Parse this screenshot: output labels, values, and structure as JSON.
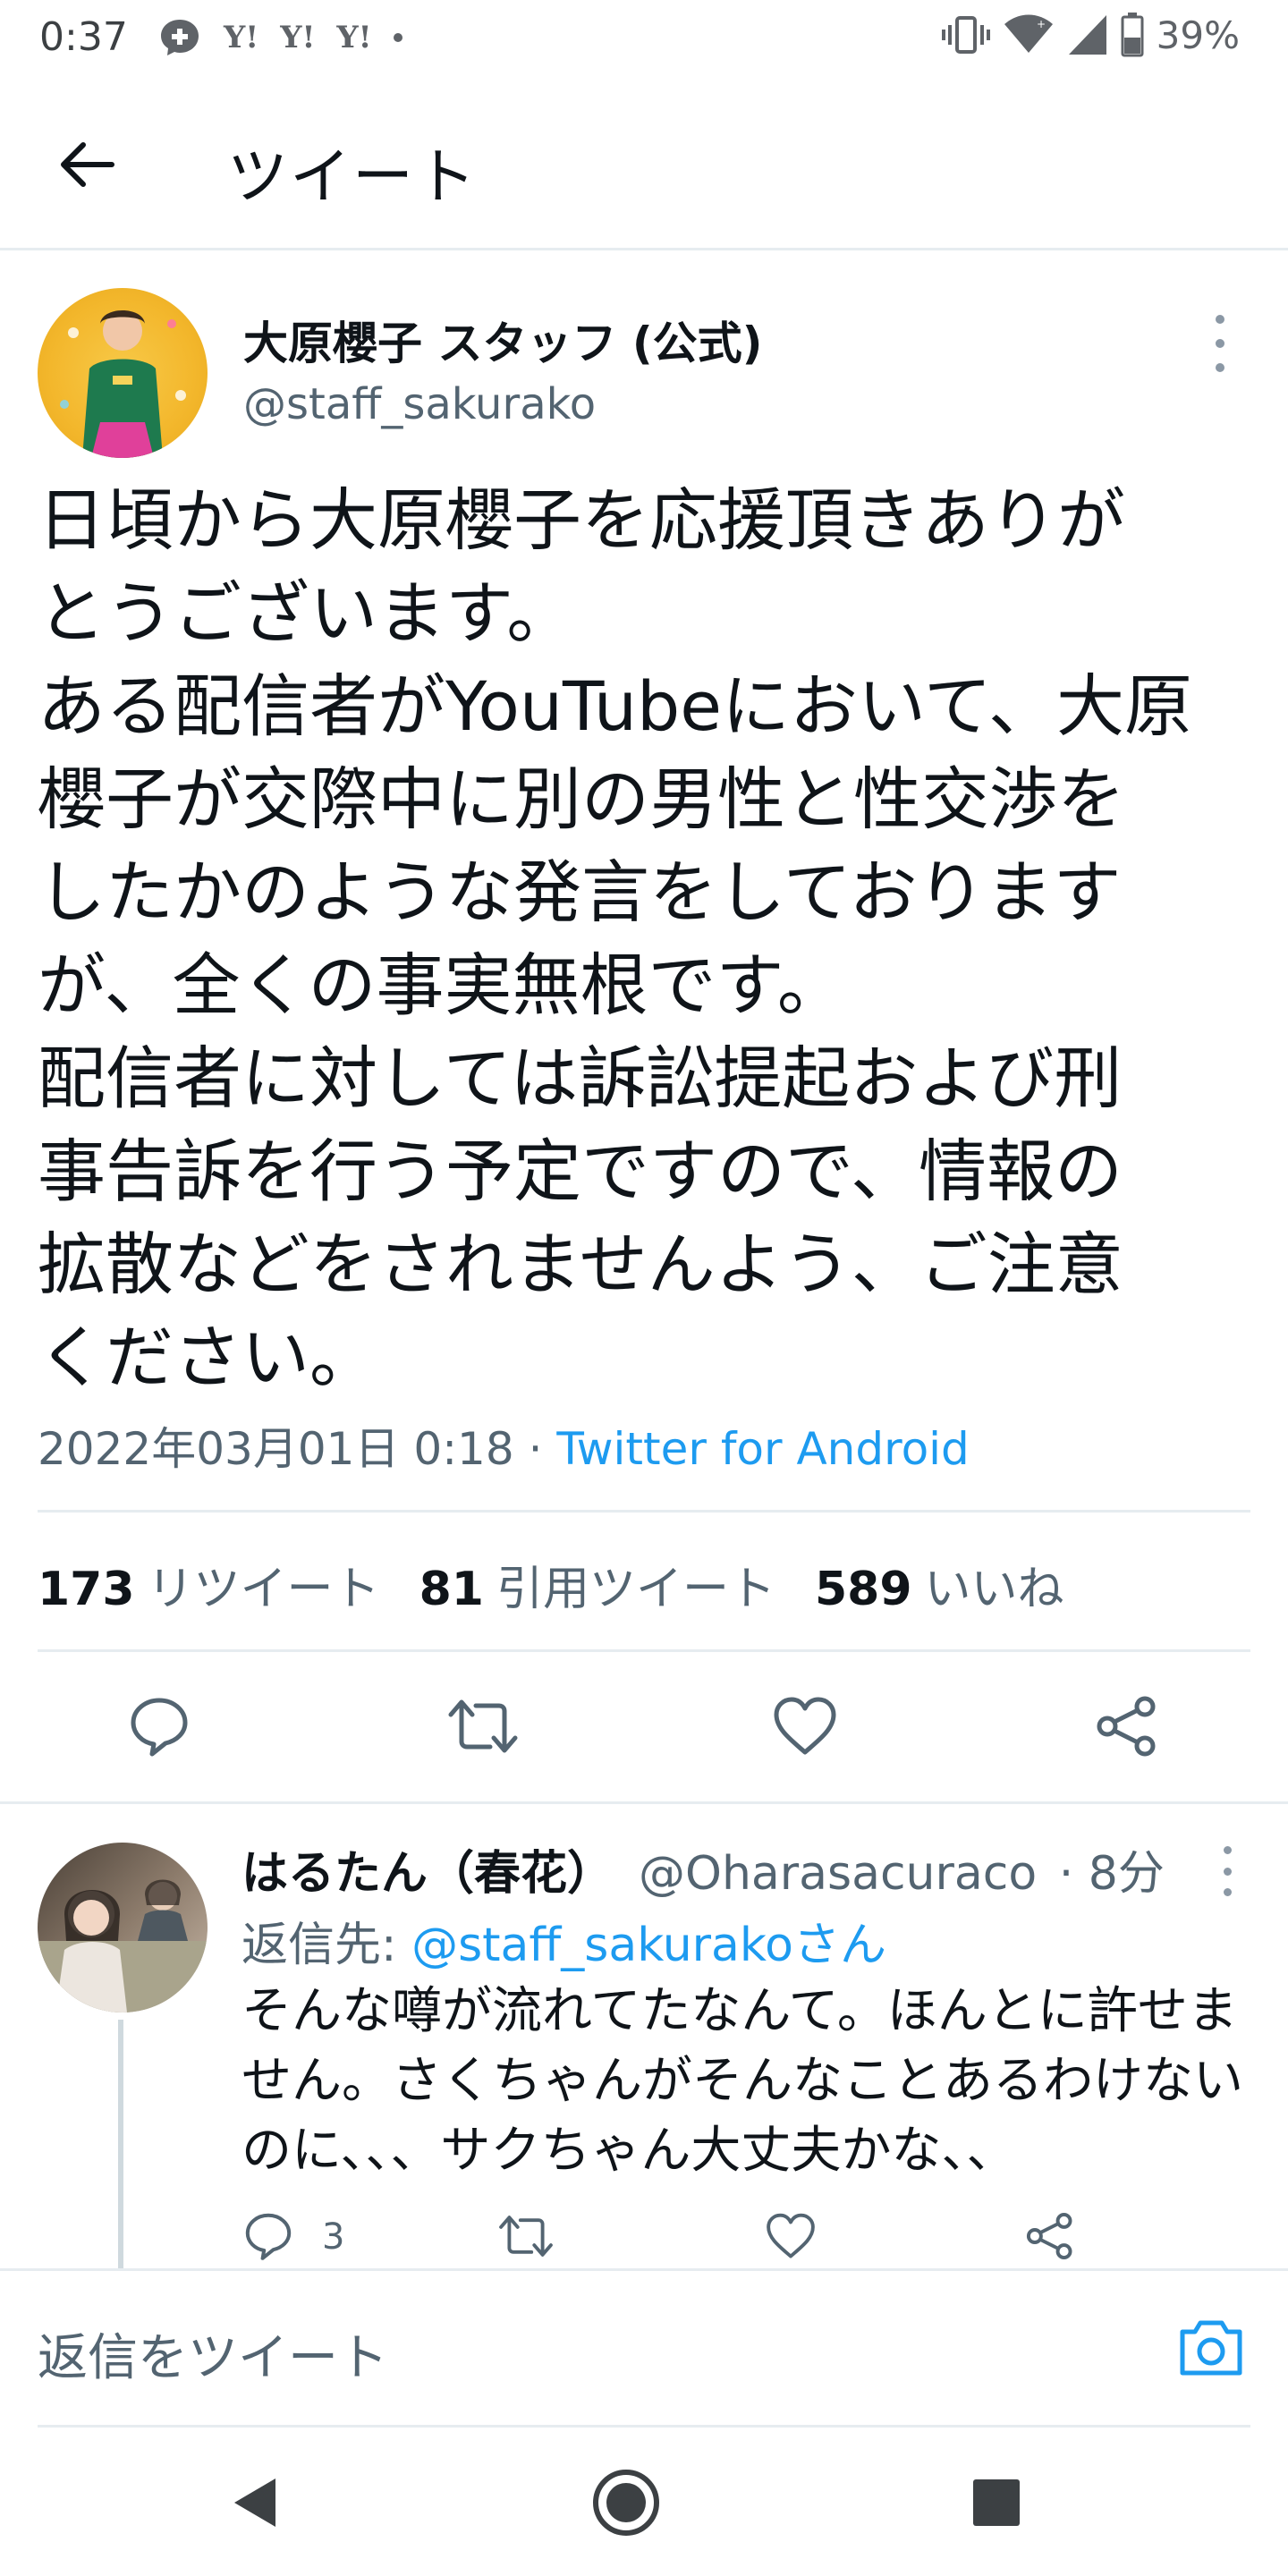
{
  "status_bar": {
    "time": "0:37",
    "left_icons": [
      "messenger-icon",
      "yahoo-icon",
      "yahoo-icon",
      "yahoo-icon",
      "notification-dot-icon"
    ],
    "yahoo_label": "Y!",
    "battery_percent": "39%",
    "right_icons": [
      "vibrate-icon",
      "wifi-icon",
      "signal-icon",
      "battery-icon"
    ]
  },
  "header": {
    "title": "ツイート",
    "back_icon": "arrow-left-icon"
  },
  "tweet": {
    "author_name": "大原櫻子 スタッフ (公式)",
    "author_handle": "@staff_sakurako",
    "text_lines": [
      "日頃から大原櫻子を応援頂きありが",
      "とうございます。",
      "ある配信者がYouTubeにおいて、大原",
      "櫻子が交際中に別の男性と性交渉を",
      "したかのような発言をしております",
      "が、全くの事実無根です。",
      "配信者に対しては訴訟提起および刑",
      "事告訴を行う予定ですので、情報の",
      "拡散などをされませんよう、ご注意",
      "ください。"
    ],
    "timestamp": "2022年03月01日 0:18",
    "separator": " · ",
    "client": "Twitter for Android",
    "stats": {
      "retweets_count": "173",
      "retweets_label": "リツイート",
      "quotes_count": "81",
      "quotes_label": "引用ツイート",
      "likes_count": "589",
      "likes_label": "いいね"
    },
    "actions": [
      "reply-icon",
      "retweet-icon",
      "like-icon",
      "share-icon"
    ]
  },
  "reply": {
    "author_name": "はるたん（春花）",
    "author_handle": "@Oharasacuraco",
    "time": "· 8分",
    "reply_to_prefix": "返信先: ",
    "reply_to_mention": "@staff_sakurakoさん",
    "text_lines": [
      "そんな噂が流れてたなんて。ほんとに許せま",
      "せん。さくちゃんがそんなことあるわけない",
      "のに、、、サクちゃん大丈夫かな、、"
    ],
    "reply_count": "3"
  },
  "compose": {
    "placeholder": "返信をツイート",
    "camera_icon": "camera-icon"
  },
  "nav_bar": {
    "buttons": [
      "back-triangle-icon",
      "home-circle-icon",
      "recents-square-icon"
    ]
  },
  "colors": {
    "accent": "#1d9bf0",
    "text_primary": "#0f1419",
    "text_secondary": "#536471",
    "divider": "#e6ecf0"
  }
}
